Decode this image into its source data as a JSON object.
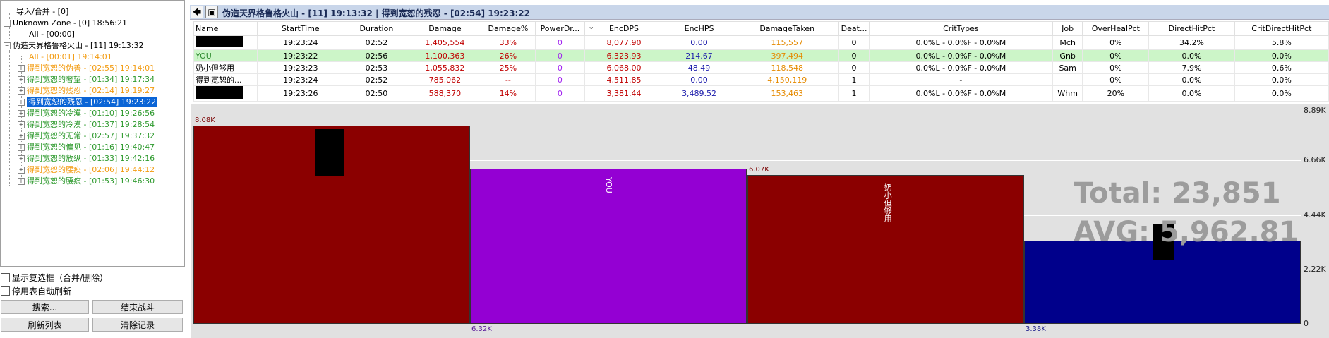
{
  "tree": {
    "root_import": "导入/合并 - [0]",
    "unknown_zone": "Unknown Zone - [0] 18:56:21",
    "unknown_all": "All - [00:00]",
    "zone": "伪造天界格鲁格火山 - [11] 19:13:32",
    "zone_all": "All - [00:01] 19:14:01",
    "encounters": [
      {
        "label": "得到宽恕的伪善 - [02:55] 19:14:01",
        "color": "orange"
      },
      {
        "label": "得到宽恕的奢望 - [01:34] 19:17:34",
        "color": "green"
      },
      {
        "label": "得到宽恕的残忍 - [02:14] 19:19:27",
        "color": "orange"
      },
      {
        "label": "得到宽恕的残忍 - [02:54] 19:23:22",
        "color": "selected"
      },
      {
        "label": "得到宽恕的冷漠 - [01:10] 19:26:56",
        "color": "green"
      },
      {
        "label": "得到宽恕的冷漠 - [01:37] 19:28:54",
        "color": "green"
      },
      {
        "label": "得到宽恕的无常 - [02:57] 19:37:32",
        "color": "green"
      },
      {
        "label": "得到宽恕的偏见 - [01:16] 19:40:47",
        "color": "green"
      },
      {
        "label": "得到宽恕的放纵 - [01:33] 19:42:16",
        "color": "green"
      },
      {
        "label": "得到宽恕的腰痰 - [02:06] 19:44:12",
        "color": "orange"
      },
      {
        "label": "得到宽恕的腰痰 - [01:53] 19:46:30",
        "color": "green"
      }
    ]
  },
  "controls": {
    "show_checkbox": "显示复选框（合并/删除）",
    "disable_refresh": "停用表自动刷新",
    "search_btn": "搜索...",
    "end_combat_btn": "结束战斗",
    "refresh_btn": "刷新列表",
    "clear_btn": "清除记录"
  },
  "header": {
    "title": "伪造天界格鲁格火山 - [11] 19:13:32 | 得到宽恕的残忍 - [02:54] 19:23:22"
  },
  "table": {
    "columns": [
      "Name",
      "StartTime",
      "Duration",
      "Damage",
      "Damage%",
      "PowerDr...",
      "EncDPS",
      "EncHPS",
      "DamageTaken",
      "Deat...",
      "CritTypes",
      "Job",
      "OverHealPct",
      "DirectHitPct",
      "CritDirectHitPct"
    ],
    "rows": [
      {
        "name": "",
        "start": "19:23:24",
        "dur": "02:52",
        "dmg": "1,405,554",
        "dmgpct": "33%",
        "power": "0",
        "encdps": "8,077.90",
        "enchps": "0.00",
        "taken": "115,557",
        "deaths": "0",
        "crit": "0.0%L - 0.0%F - 0.0%M",
        "job": "Mch",
        "overheal": "0%",
        "dh": "34.2%",
        "cdh": "5.8%"
      },
      {
        "name": "YOU",
        "start": "19:23:22",
        "dur": "02:56",
        "dmg": "1,100,363",
        "dmgpct": "26%",
        "power": "0",
        "encdps": "6,323.93",
        "enchps": "214.67",
        "taken": "397,494",
        "deaths": "0",
        "crit": "0.0%L - 0.0%F - 0.0%M",
        "job": "Gnb",
        "overheal": "0%",
        "dh": "0.0%",
        "cdh": "0.0%"
      },
      {
        "name": "奶小但够用",
        "start": "19:23:23",
        "dur": "02:53",
        "dmg": "1,055,832",
        "dmgpct": "25%",
        "power": "0",
        "encdps": "6,068.00",
        "enchps": "48.49",
        "taken": "118,548",
        "deaths": "0",
        "crit": "0.0%L - 0.0%F - 0.0%M",
        "job": "Sam",
        "overheal": "0%",
        "dh": "7.9%",
        "cdh": "0.6%"
      },
      {
        "name": "得到宽恕的...",
        "start": "19:23:24",
        "dur": "02:52",
        "dmg": "785,062",
        "dmgpct": "--",
        "power": "0",
        "encdps": "4,511.85",
        "enchps": "0.00",
        "taken": "4,150,119",
        "deaths": "1",
        "crit": "-",
        "job": "",
        "overheal": "0%",
        "dh": "0.0%",
        "cdh": "0.0%"
      },
      {
        "name": "",
        "start": "19:23:26",
        "dur": "02:50",
        "dmg": "588,370",
        "dmgpct": "14%",
        "power": "0",
        "encdps": "3,381.44",
        "enchps": "3,489.52",
        "taken": "153,463",
        "deaths": "1",
        "crit": "0.0%L - 0.0%F - 0.0%M",
        "job": "Whm",
        "overheal": "20%",
        "dh": "0.0%",
        "cdh": "0.0%"
      }
    ]
  },
  "graph": {
    "y_ticks": [
      "8.89K",
      "6.66K",
      "4.44K",
      "2.22K",
      "0"
    ],
    "y_max": 8890,
    "bars": [
      {
        "value": 8077.9,
        "label": "8.08K",
        "vertical_name": "",
        "color": "#8b0000",
        "label_pos": "top",
        "label_color": "#7a0000"
      },
      {
        "value": 6323.93,
        "label": "6.32K",
        "vertical_name": "YOU",
        "color": "#9400d3",
        "label_pos": "bottom",
        "label_color": "#5a1a9a"
      },
      {
        "value": 6068.0,
        "label": "6.07K",
        "vertical_name": "奶小但够用",
        "color": "#8b0000",
        "label_pos": "top",
        "label_color": "#7a0000"
      },
      {
        "value": 3381.44,
        "label": "3.38K",
        "vertical_name": "",
        "color": "#00008b",
        "label_pos": "bottom",
        "label_color": "#1a1a8b"
      }
    ],
    "total": "Total: 23,851",
    "avg": "AVG: 5,962.81"
  }
}
